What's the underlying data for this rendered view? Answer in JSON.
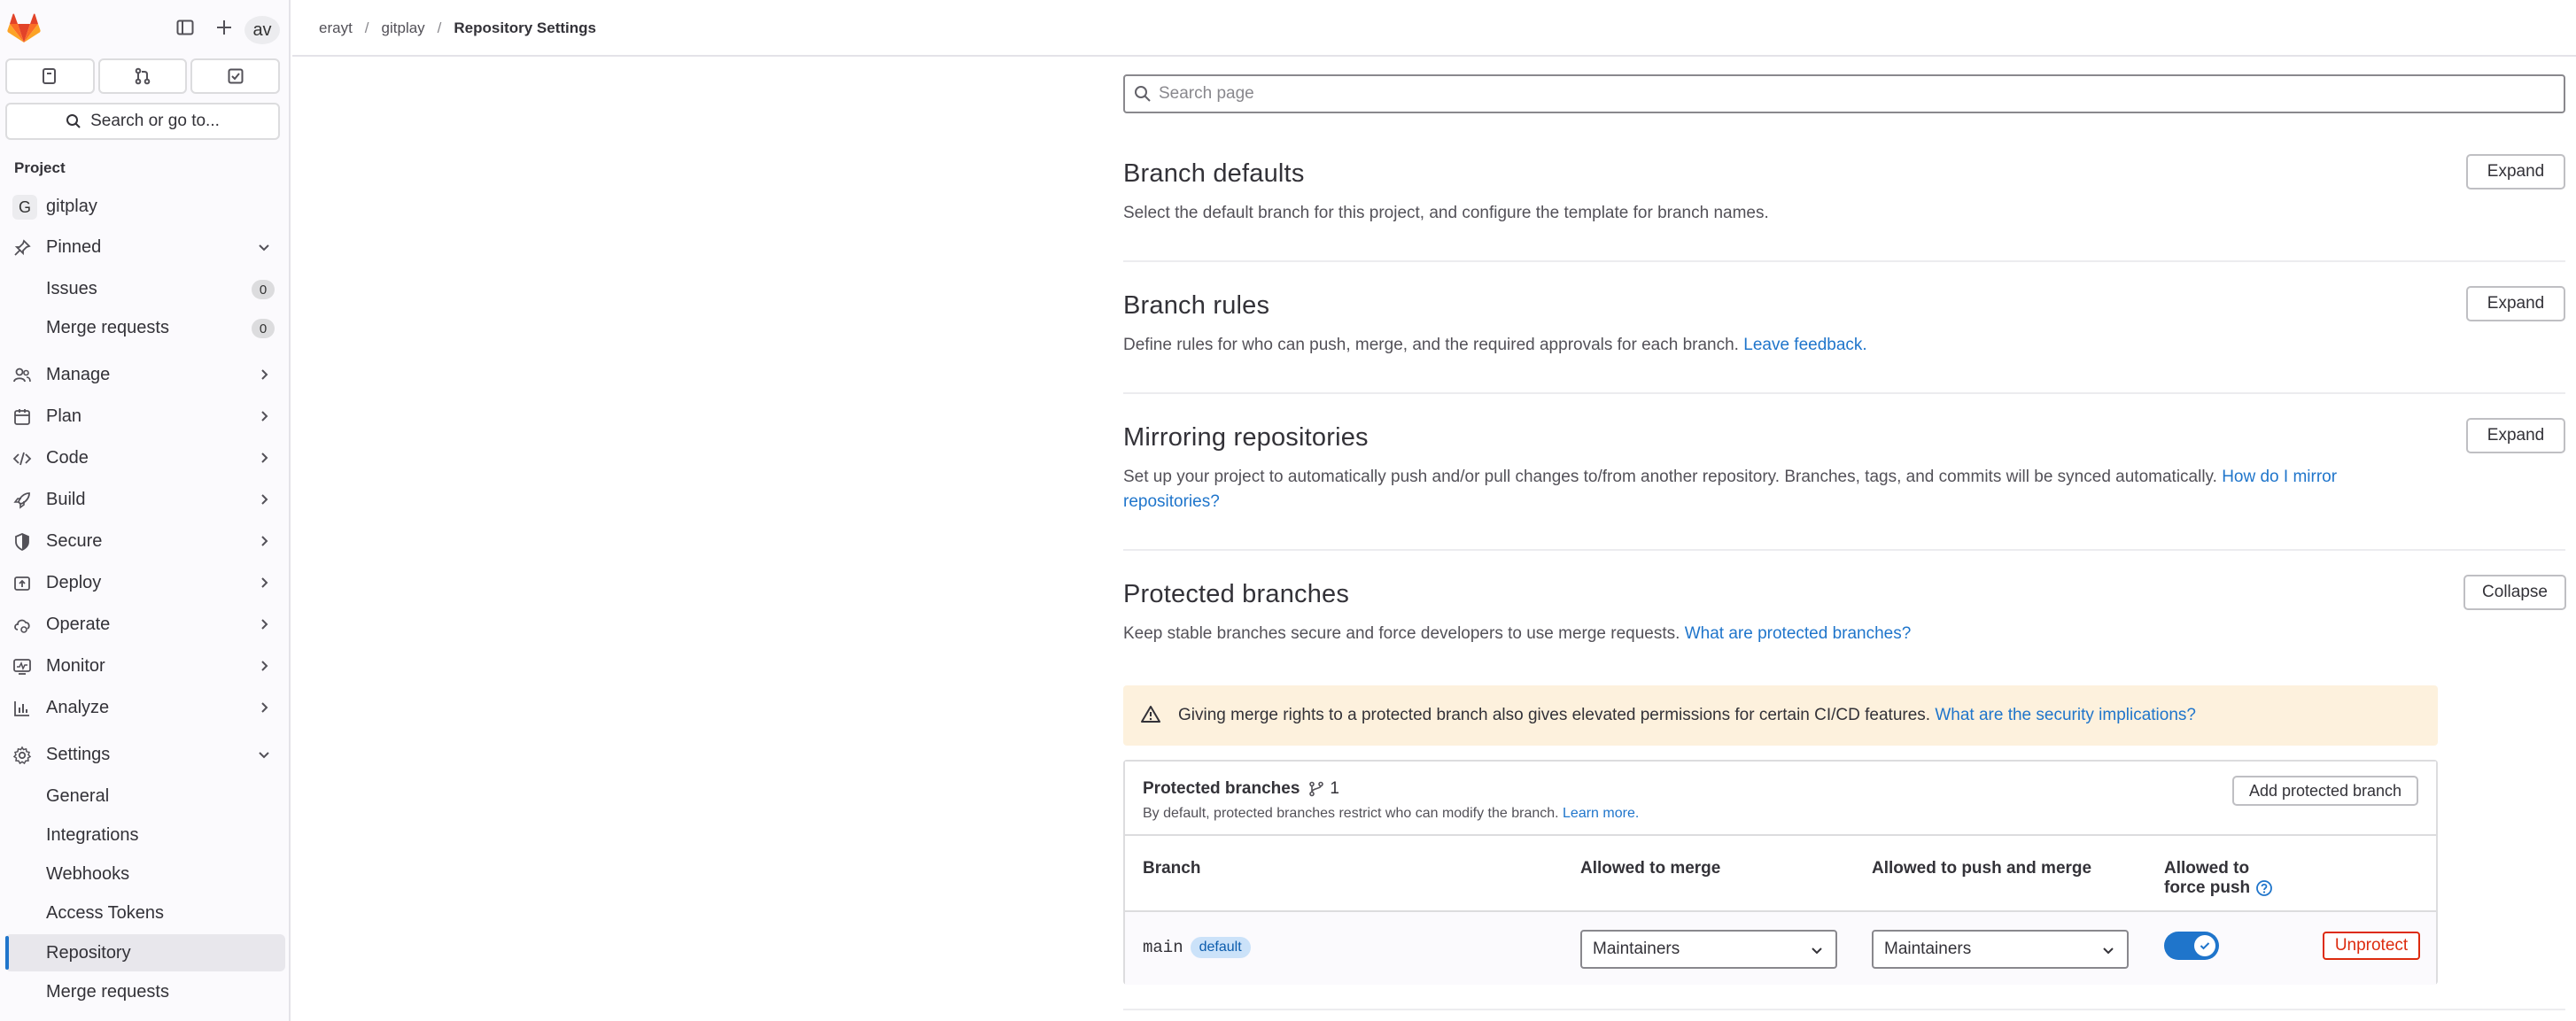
{
  "breadcrumb": [
    "erayt",
    "gitplay",
    "Repository Settings"
  ],
  "sidebar": {
    "avatar_text": "av",
    "search_label": "Search or go to...",
    "section_label": "Project",
    "project_badge": "G",
    "project_name": "gitplay",
    "pinned_label": "Pinned",
    "pinned_items": [
      {
        "label": "Issues",
        "count": "0"
      },
      {
        "label": "Merge requests",
        "count": "0"
      }
    ],
    "groups": [
      {
        "label": "Manage",
        "icon": "users-icon"
      },
      {
        "label": "Plan",
        "icon": "calendar-icon"
      },
      {
        "label": "Code",
        "icon": "code-icon"
      },
      {
        "label": "Build",
        "icon": "rocket-icon"
      },
      {
        "label": "Secure",
        "icon": "shield-icon"
      },
      {
        "label": "Deploy",
        "icon": "deploy-icon"
      },
      {
        "label": "Operate",
        "icon": "cloud-gear-icon"
      },
      {
        "label": "Monitor",
        "icon": "monitor-icon"
      },
      {
        "label": "Analyze",
        "icon": "chart-icon"
      }
    ],
    "settings_label": "Settings",
    "settings_items": [
      "General",
      "Integrations",
      "Webhooks",
      "Access Tokens",
      "Repository",
      "Merge requests"
    ],
    "active_item": "Repository"
  },
  "main": {
    "search_placeholder": "Search page",
    "sections": [
      {
        "title": "Branch defaults",
        "desc": "Select the default branch for this project, and configure the template for branch names.",
        "button": "Expand"
      },
      {
        "title": "Branch rules",
        "desc": "Define rules for who can push, merge, and the required approvals for each branch.",
        "link": "Leave feedback.",
        "button": "Expand"
      },
      {
        "title": "Mirroring repositories",
        "desc": "Set up your project to automatically push and/or pull changes to/from another repository. Branches, tags, and commits will be synced automatically.",
        "link": "How do I mirror repositories?",
        "button": "Expand"
      },
      {
        "title": "Protected branches",
        "desc": "Keep stable branches secure and force developers to use merge requests.",
        "link": "What are protected branches?",
        "button": "Collapse"
      }
    ],
    "alert": {
      "text": "Giving merge rights to a protected branch also gives elevated permissions for certain CI/CD features.",
      "link": "What are the security implications?"
    },
    "card": {
      "title": "Protected branches",
      "count": "1",
      "subtitle": "By default, protected branches restrict who can modify the branch.",
      "subtitle_link": "Learn more.",
      "add_button": "Add protected branch",
      "columns": [
        "Branch",
        "Allowed to merge",
        "Allowed to push and merge",
        "Allowed to",
        "force push"
      ],
      "row": {
        "branch": "main",
        "badge": "default",
        "merge": "Maintainers",
        "push": "Maintainers",
        "force_push": true,
        "unprotect": "Unprotect"
      }
    }
  }
}
